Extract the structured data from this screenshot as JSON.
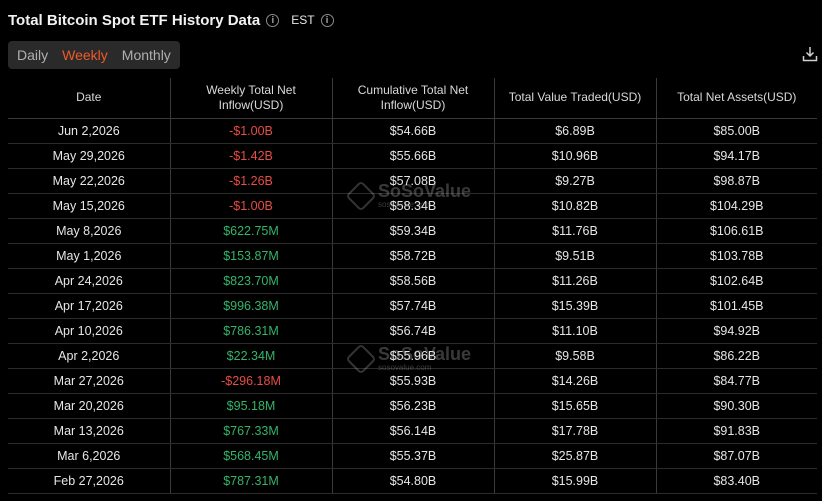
{
  "header": {
    "title": "Total Bitcoin Spot ETF History Data",
    "timezone": "EST"
  },
  "tabs": [
    {
      "label": "Daily",
      "active": false
    },
    {
      "label": "Weekly",
      "active": true
    },
    {
      "label": "Monthly",
      "active": false
    }
  ],
  "accent_color": "#f0592a",
  "positive_color": "#34b46a",
  "negative_color": "#e54d45",
  "watermark": {
    "name": "SoSoValue",
    "url": "sosovalue.com"
  },
  "table": {
    "columns": [
      "Date",
      "Weekly Total Net Inflow(USD)",
      "Cumulative Total Net Inflow(USD)",
      "Total Value Traded(USD)",
      "Total Net Assets(USD)"
    ],
    "rows": [
      {
        "date": "Jun 2,2026",
        "inflow": "-$1.00B",
        "sign": "neg",
        "cumulative": "$54.66B",
        "traded": "$6.89B",
        "assets": "$85.00B"
      },
      {
        "date": "May 29,2026",
        "inflow": "-$1.42B",
        "sign": "neg",
        "cumulative": "$55.66B",
        "traded": "$10.96B",
        "assets": "$94.17B"
      },
      {
        "date": "May 22,2026",
        "inflow": "-$1.26B",
        "sign": "neg",
        "cumulative": "$57.08B",
        "traded": "$9.27B",
        "assets": "$98.87B"
      },
      {
        "date": "May 15,2026",
        "inflow": "-$1.00B",
        "sign": "neg",
        "cumulative": "$58.34B",
        "traded": "$10.82B",
        "assets": "$104.29B"
      },
      {
        "date": "May 8,2026",
        "inflow": "$622.75M",
        "sign": "pos",
        "cumulative": "$59.34B",
        "traded": "$11.76B",
        "assets": "$106.61B"
      },
      {
        "date": "May 1,2026",
        "inflow": "$153.87M",
        "sign": "pos",
        "cumulative": "$58.72B",
        "traded": "$9.51B",
        "assets": "$103.78B"
      },
      {
        "date": "Apr 24,2026",
        "inflow": "$823.70M",
        "sign": "pos",
        "cumulative": "$58.56B",
        "traded": "$11.26B",
        "assets": "$102.64B"
      },
      {
        "date": "Apr 17,2026",
        "inflow": "$996.38M",
        "sign": "pos",
        "cumulative": "$57.74B",
        "traded": "$15.39B",
        "assets": "$101.45B"
      },
      {
        "date": "Apr 10,2026",
        "inflow": "$786.31M",
        "sign": "pos",
        "cumulative": "$56.74B",
        "traded": "$11.10B",
        "assets": "$94.92B"
      },
      {
        "date": "Apr 2,2026",
        "inflow": "$22.34M",
        "sign": "pos",
        "cumulative": "$55.96B",
        "traded": "$9.58B",
        "assets": "$86.22B"
      },
      {
        "date": "Mar 27,2026",
        "inflow": "-$296.18M",
        "sign": "neg",
        "cumulative": "$55.93B",
        "traded": "$14.26B",
        "assets": "$84.77B"
      },
      {
        "date": "Mar 20,2026",
        "inflow": "$95.18M",
        "sign": "pos",
        "cumulative": "$56.23B",
        "traded": "$15.65B",
        "assets": "$90.30B"
      },
      {
        "date": "Mar 13,2026",
        "inflow": "$767.33M",
        "sign": "pos",
        "cumulative": "$56.14B",
        "traded": "$17.78B",
        "assets": "$91.83B"
      },
      {
        "date": "Mar 6,2026",
        "inflow": "$568.45M",
        "sign": "pos",
        "cumulative": "$55.37B",
        "traded": "$25.87B",
        "assets": "$87.07B"
      },
      {
        "date": "Feb 27,2026",
        "inflow": "$787.31M",
        "sign": "pos",
        "cumulative": "$54.80B",
        "traded": "$15.99B",
        "assets": "$83.40B"
      }
    ]
  }
}
